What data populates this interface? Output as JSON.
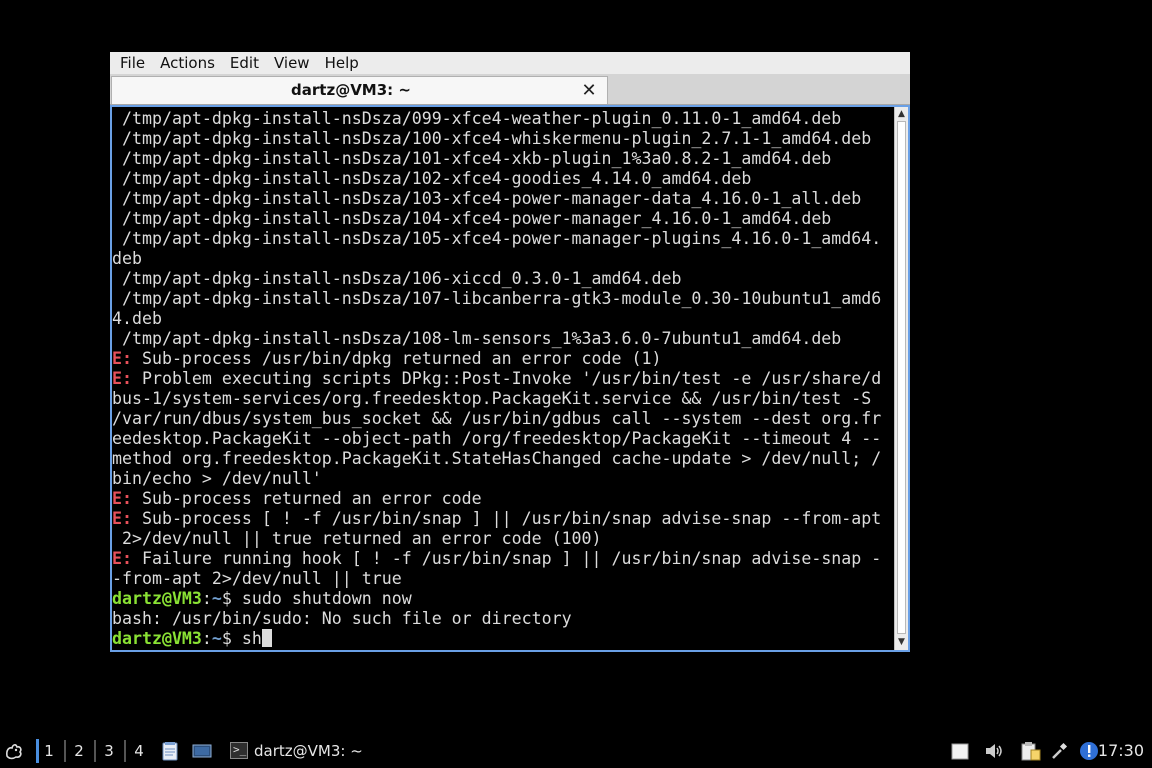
{
  "window": {
    "menu": [
      "File",
      "Actions",
      "Edit",
      "View",
      "Help"
    ],
    "tab_title": "dartz@VM3: ~",
    "tab_close": "✕"
  },
  "terminal": {
    "lines": [
      {
        "type": "plain",
        "text": " /tmp/apt-dpkg-install-nsDsza/099-xfce4-weather-plugin_0.11.0-1_amd64.deb"
      },
      {
        "type": "plain",
        "text": " /tmp/apt-dpkg-install-nsDsza/100-xfce4-whiskermenu-plugin_2.7.1-1_amd64.deb"
      },
      {
        "type": "plain",
        "text": " /tmp/apt-dpkg-install-nsDsza/101-xfce4-xkb-plugin_1%3a0.8.2-1_amd64.deb"
      },
      {
        "type": "plain",
        "text": " /tmp/apt-dpkg-install-nsDsza/102-xfce4-goodies_4.14.0_amd64.deb"
      },
      {
        "type": "plain",
        "text": " /tmp/apt-dpkg-install-nsDsza/103-xfce4-power-manager-data_4.16.0-1_all.deb"
      },
      {
        "type": "plain",
        "text": " /tmp/apt-dpkg-install-nsDsza/104-xfce4-power-manager_4.16.0-1_amd64.deb"
      },
      {
        "type": "plain",
        "text": " /tmp/apt-dpkg-install-nsDsza/105-xfce4-power-manager-plugins_4.16.0-1_amd64."
      },
      {
        "type": "plain",
        "text": "deb"
      },
      {
        "type": "plain",
        "text": " /tmp/apt-dpkg-install-nsDsza/106-xiccd_0.3.0-1_amd64.deb"
      },
      {
        "type": "plain",
        "text": " /tmp/apt-dpkg-install-nsDsza/107-libcanberra-gtk3-module_0.30-10ubuntu1_amd6"
      },
      {
        "type": "plain",
        "text": "4.deb"
      },
      {
        "type": "plain",
        "text": " /tmp/apt-dpkg-install-nsDsza/108-lm-sensors_1%3a3.6.0-7ubuntu1_amd64.deb"
      },
      {
        "type": "error",
        "prefix": "E:",
        "text": " Sub-process /usr/bin/dpkg returned an error code (1)"
      },
      {
        "type": "error",
        "prefix": "E:",
        "text": " Problem executing scripts DPkg::Post-Invoke '/usr/bin/test -e /usr/share/d"
      },
      {
        "type": "plain",
        "text": "bus-1/system-services/org.freedesktop.PackageKit.service && /usr/bin/test -S"
      },
      {
        "type": "plain",
        "text": "/var/run/dbus/system_bus_socket && /usr/bin/gdbus call --system --dest org.fr"
      },
      {
        "type": "plain",
        "text": "eedesktop.PackageKit --object-path /org/freedesktop/PackageKit --timeout 4 --"
      },
      {
        "type": "plain",
        "text": "method org.freedesktop.PackageKit.StateHasChanged cache-update > /dev/null; /"
      },
      {
        "type": "plain",
        "text": "bin/echo > /dev/null'"
      },
      {
        "type": "error",
        "prefix": "E:",
        "text": " Sub-process returned an error code"
      },
      {
        "type": "error",
        "prefix": "E:",
        "text": " Sub-process [ ! -f /usr/bin/snap ] || /usr/bin/snap advise-snap --from-apt"
      },
      {
        "type": "plain",
        "text": " 2>/dev/null || true returned an error code (100)"
      },
      {
        "type": "error",
        "prefix": "E:",
        "text": " Failure running hook [ ! -f /usr/bin/snap ] || /usr/bin/snap advise-snap -"
      },
      {
        "type": "plain",
        "text": "-from-apt 2>/dev/null || true"
      },
      {
        "type": "prompt",
        "user": "dartz@VM3",
        "sep": ":",
        "path": "~",
        "dollar": "$ ",
        "command": "sudo shutdown now"
      },
      {
        "type": "plain",
        "text": "bash: /usr/bin/sudo: No such file or directory"
      },
      {
        "type": "prompt",
        "user": "dartz@VM3",
        "sep": ":",
        "path": "~",
        "dollar": "$ ",
        "command": "sh",
        "cursor": true
      }
    ]
  },
  "taskbar": {
    "workspaces": [
      "1",
      "2",
      "3",
      "4"
    ],
    "active_workspace": "1",
    "task_label": "dartz@VM3: ~",
    "clock": "17:30",
    "icons": {
      "start": "xfce-mouse-icon",
      "launcher1": "text-editor-icon",
      "launcher2": "monitor-icon",
      "tray1": "notes-icon",
      "tray2": "volume-icon",
      "tray3": "clipboard-icon",
      "tray4": "network-icon",
      "tray5": "update-notification-icon"
    }
  }
}
